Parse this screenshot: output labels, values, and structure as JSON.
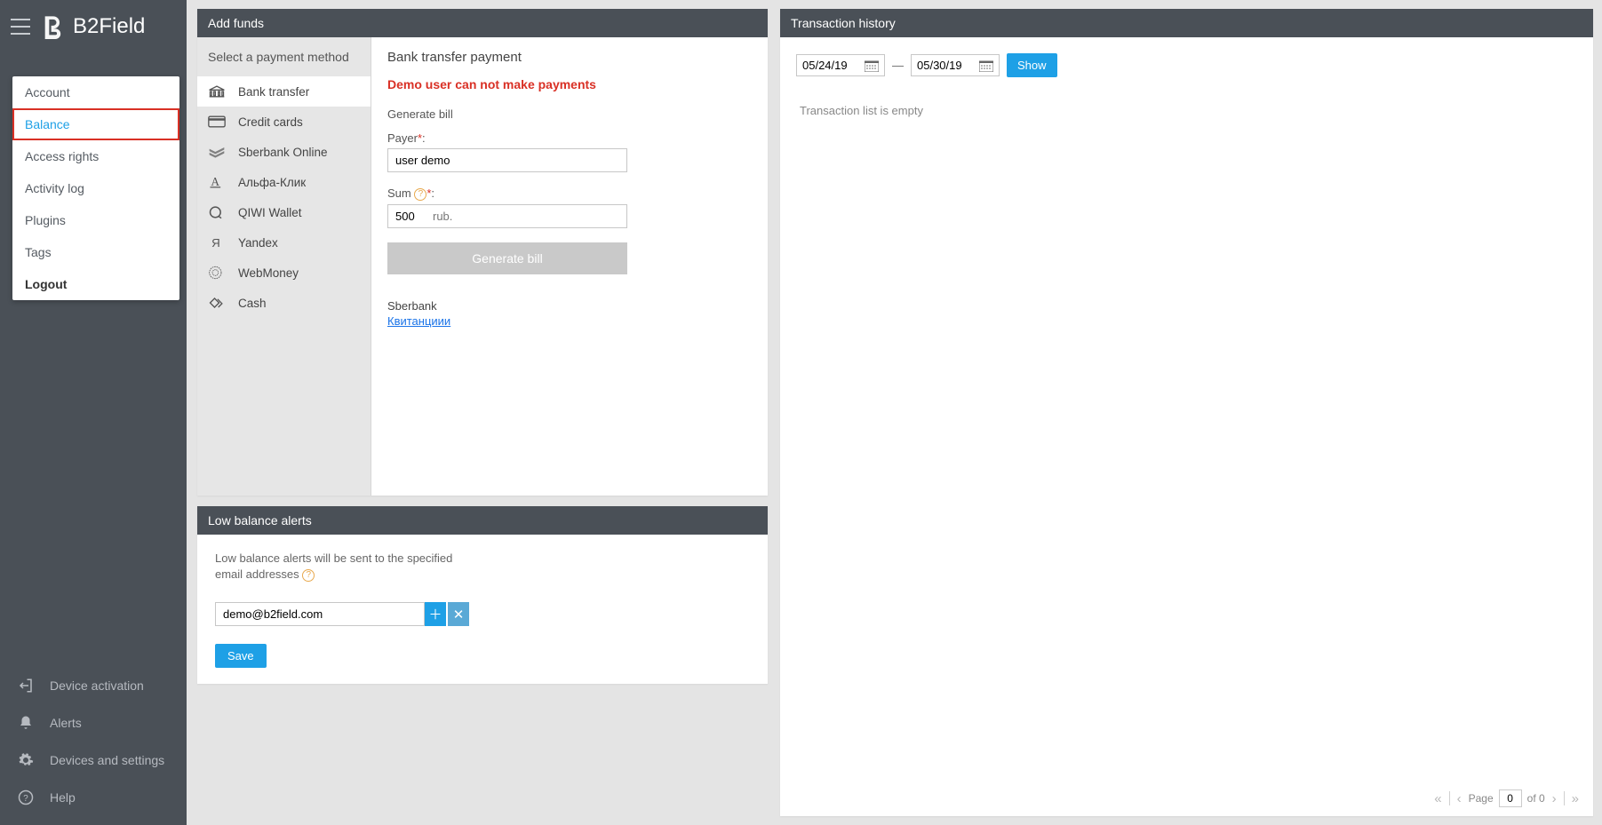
{
  "brand": "B2Field",
  "popup": {
    "items": [
      {
        "label": "Account"
      },
      {
        "label": "Balance",
        "active": true
      },
      {
        "label": "Access rights"
      },
      {
        "label": "Activity log"
      },
      {
        "label": "Plugins"
      },
      {
        "label": "Tags"
      },
      {
        "label": "Logout",
        "logout": true
      }
    ]
  },
  "sidebar_bottom": {
    "device_activation": "Device activation",
    "alerts": "Alerts",
    "devices_settings": "Devices and settings",
    "help": "Help"
  },
  "addfunds": {
    "title": "Add funds",
    "select_label": "Select a payment method",
    "methods": [
      {
        "label": "Bank transfer",
        "active": true,
        "icon": "bank"
      },
      {
        "label": "Credit cards",
        "icon": "card"
      },
      {
        "label": "Sberbank Online",
        "icon": "sber"
      },
      {
        "label": "Альфа-Клик",
        "icon": "alfa"
      },
      {
        "label": "QIWI Wallet",
        "icon": "qiwi"
      },
      {
        "label": "Yandex",
        "icon": "yandex"
      },
      {
        "label": "WebMoney",
        "icon": "wm"
      },
      {
        "label": "Cash",
        "icon": "cash"
      }
    ],
    "form": {
      "heading": "Bank transfer payment",
      "warning": "Demo user can not make payments",
      "subhead": "Generate bill",
      "payer_label": "Payer",
      "payer_value": "user demo",
      "sum_label": "Sum",
      "sum_value": "500",
      "sum_unit": "rub.",
      "button": "Generate bill",
      "sberbank_label": "Sberbank",
      "receipt_link": "Квитанциии"
    }
  },
  "lowbalance": {
    "title": "Low balance alerts",
    "desc": "Low balance alerts will be sent to the specified email addresses",
    "email": "demo@b2field.com",
    "save": "Save"
  },
  "history": {
    "title": "Transaction history",
    "date_from": "05/24/19",
    "date_to": "05/30/19",
    "show": "Show",
    "empty": "Transaction list is empty",
    "pager": {
      "page_label": "Page",
      "page": "0",
      "of_label": "of 0"
    }
  }
}
